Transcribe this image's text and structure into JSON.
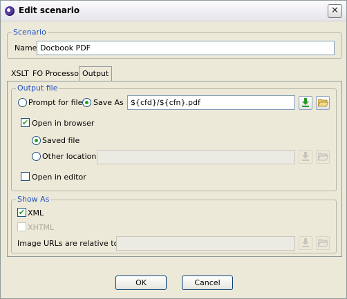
{
  "window": {
    "title": "Edit scenario"
  },
  "scenario": {
    "legend": "Scenario",
    "name_label": "Name",
    "name_value": "Docbook PDF"
  },
  "tabs": [
    "XSLT",
    "FO Processor",
    "Output"
  ],
  "output_file": {
    "legend": "Output file",
    "prompt_label": "Prompt for file",
    "save_as_label": "Save As",
    "save_as_value": "${cfd}/${cfn}.pdf",
    "open_in_browser_label": "Open in browser",
    "saved_file_label": "Saved file",
    "other_location_label": "Other location",
    "other_location_value": "",
    "open_in_editor_label": "Open in editor"
  },
  "show_as": {
    "legend": "Show As",
    "xml_label": "XML",
    "xhtml_label": "XHTML",
    "image_urls_label": "Image URLs are relative to:",
    "image_urls_value": ""
  },
  "buttons": {
    "ok": "OK",
    "cancel": "Cancel"
  },
  "icons": {
    "close": "close-icon",
    "download": "download-icon",
    "folder": "folder-open-icon"
  },
  "colors": {
    "legend": "#2050c0",
    "check": "#21a121",
    "dialog_bg": "#ece9d8"
  }
}
